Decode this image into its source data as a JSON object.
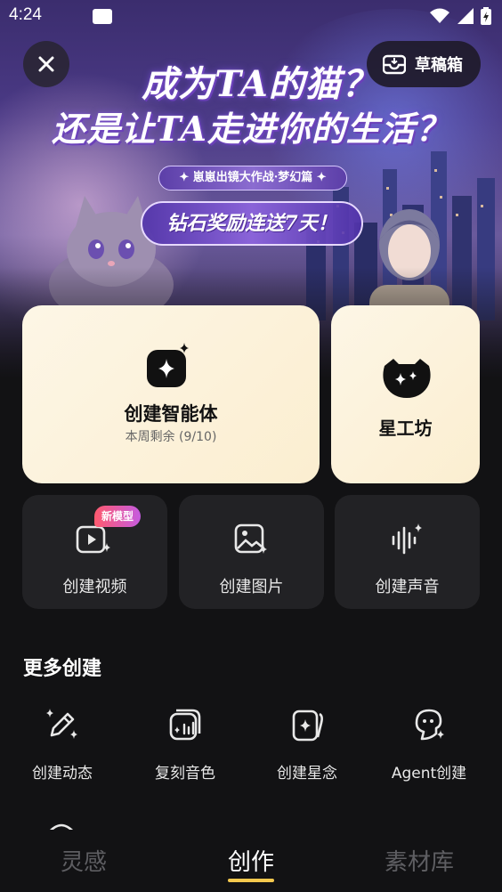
{
  "status_bar": {
    "time": "4:24"
  },
  "banner": {
    "title_line1": "成为TA的猫？",
    "title_line2": "还是让TA走进你的生活？",
    "subtitle": "✦ 崽崽出镜大作战·梦幻篇 ✦",
    "reward": "钻石奖励连送7天！"
  },
  "header": {
    "draft_label": "草稿箱"
  },
  "cards": {
    "agent": {
      "title": "创建智能体",
      "subtitle": "本周剩余 (9/10)"
    },
    "star_workshop": {
      "title": "星工坊"
    },
    "small": [
      {
        "label": "创建视频",
        "badge": "新模型"
      },
      {
        "label": "创建图片"
      },
      {
        "label": "创建声音"
      }
    ]
  },
  "more": {
    "title": "更多创建",
    "items": [
      {
        "label": "创建动态",
        "icon": "magic-pen-icon"
      },
      {
        "label": "复刻音色",
        "icon": "voice-clone-icon"
      },
      {
        "label": "创建星念",
        "icon": "star-card-icon"
      },
      {
        "label": "Agent创建",
        "icon": "agent-icon"
      }
    ]
  },
  "nav": {
    "tabs": [
      {
        "label": "灵感",
        "active": false
      },
      {
        "label": "创作",
        "active": true
      },
      {
        "label": "素材库",
        "active": false
      }
    ]
  },
  "colors": {
    "accent": "#f5c94e",
    "card_cream": "#fdf6e6",
    "dark_card": "#222225",
    "background": "#121214"
  }
}
